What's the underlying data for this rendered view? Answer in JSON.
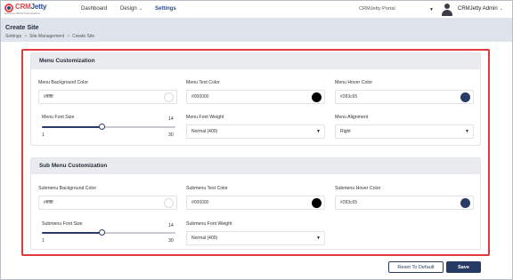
{
  "nav": {
    "logo_text_a": "CRM",
    "logo_text_b": "Jetty",
    "logo_tagline": "Enterprise CRM & Portal Solutions",
    "items": [
      {
        "label": "Dashboard"
      },
      {
        "label": "Design"
      },
      {
        "label": "Settings",
        "active": true
      }
    ],
    "portal": "CRMJetty Portal",
    "user": "CRMJetty Admin"
  },
  "header": {
    "title": "Create Site",
    "breadcrumb": [
      "Settings",
      "Site Management",
      "Create Site"
    ],
    "breadcrumb_sep": ">"
  },
  "menu": {
    "title": "Menu Customization",
    "bg_color": {
      "label": "Menu Background Color",
      "value": "#ffffff",
      "swatch": "#ffffff"
    },
    "text_color": {
      "label": "Menu Text Color",
      "value": "#000000",
      "swatch": "#000000"
    },
    "hover_color": {
      "label": "Menu Hover Color",
      "value": "#283c65",
      "swatch": "#283c65"
    },
    "font_size": {
      "label": "Menu Font Size",
      "value": 14,
      "min": "1",
      "max": "30",
      "value_text": "14"
    },
    "font_weight": {
      "label": "Menu Font Weight",
      "value": "Normal (400)"
    },
    "alignment": {
      "label": "Menu Alignment",
      "value": "Right"
    }
  },
  "submenu": {
    "title": "Sub Menu Customization",
    "bg_color": {
      "label": "Submenu Background Color",
      "value": "#ffffff",
      "swatch": "#ffffff"
    },
    "text_color": {
      "label": "Submenu Text Color",
      "value": "#000000",
      "swatch": "#000000"
    },
    "hover_color": {
      "label": "Submenu Hover Color",
      "value": "#283c65",
      "swatch": "#283c65"
    },
    "font_size": {
      "label": "Submenu Font Size",
      "value": 14,
      "min": "1",
      "max": "30",
      "value_text": "14"
    },
    "font_weight": {
      "label": "Submenu Font Weight",
      "value": "Normal (400)"
    }
  },
  "actions": {
    "reset": "Reset To Default",
    "save": "Save"
  },
  "theme": {
    "accent": "#263a66",
    "outline": "#e23a3a",
    "header_bg": "#dfe4ec"
  }
}
